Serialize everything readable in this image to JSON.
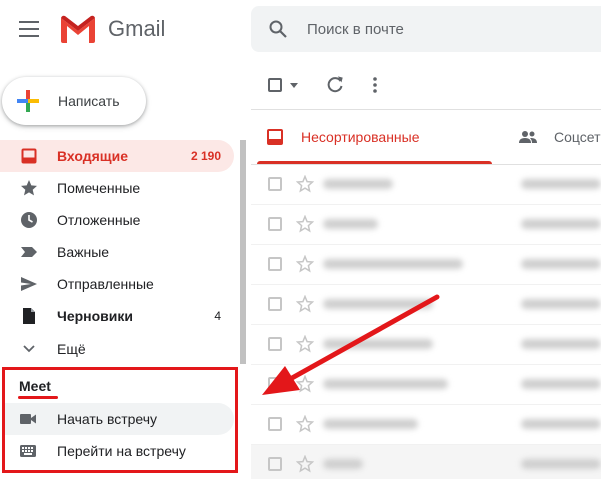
{
  "header": {
    "app_name": "Gmail",
    "search_placeholder": "Поиск в почте"
  },
  "compose": {
    "label": "Написать"
  },
  "sidebar": {
    "items": [
      {
        "label": "Входящие",
        "count": "2 190",
        "icon": "inbox-icon",
        "active": true
      },
      {
        "label": "Помеченные",
        "count": "",
        "icon": "star-icon"
      },
      {
        "label": "Отложенные",
        "count": "",
        "icon": "clock-icon"
      },
      {
        "label": "Важные",
        "count": "",
        "icon": "label-important-icon"
      },
      {
        "label": "Отправленные",
        "count": "",
        "icon": "send-icon"
      },
      {
        "label": "Черновики",
        "count": "4",
        "icon": "draft-icon",
        "bold": true
      },
      {
        "label": "Ещё",
        "count": "",
        "icon": "chevron-down-icon"
      }
    ]
  },
  "meet": {
    "title": "Meet",
    "items": [
      {
        "label": "Начать встречу",
        "icon": "videocam-icon"
      },
      {
        "label": "Перейти на встречу",
        "icon": "keyboard-icon"
      }
    ]
  },
  "tabs": [
    {
      "label": "Несортированные",
      "icon": "inbox-icon",
      "active": true
    },
    {
      "label": "Соцсет",
      "icon": "people-icon"
    }
  ],
  "colors": {
    "accent": "#d93025",
    "annotation": "#e3171a"
  }
}
